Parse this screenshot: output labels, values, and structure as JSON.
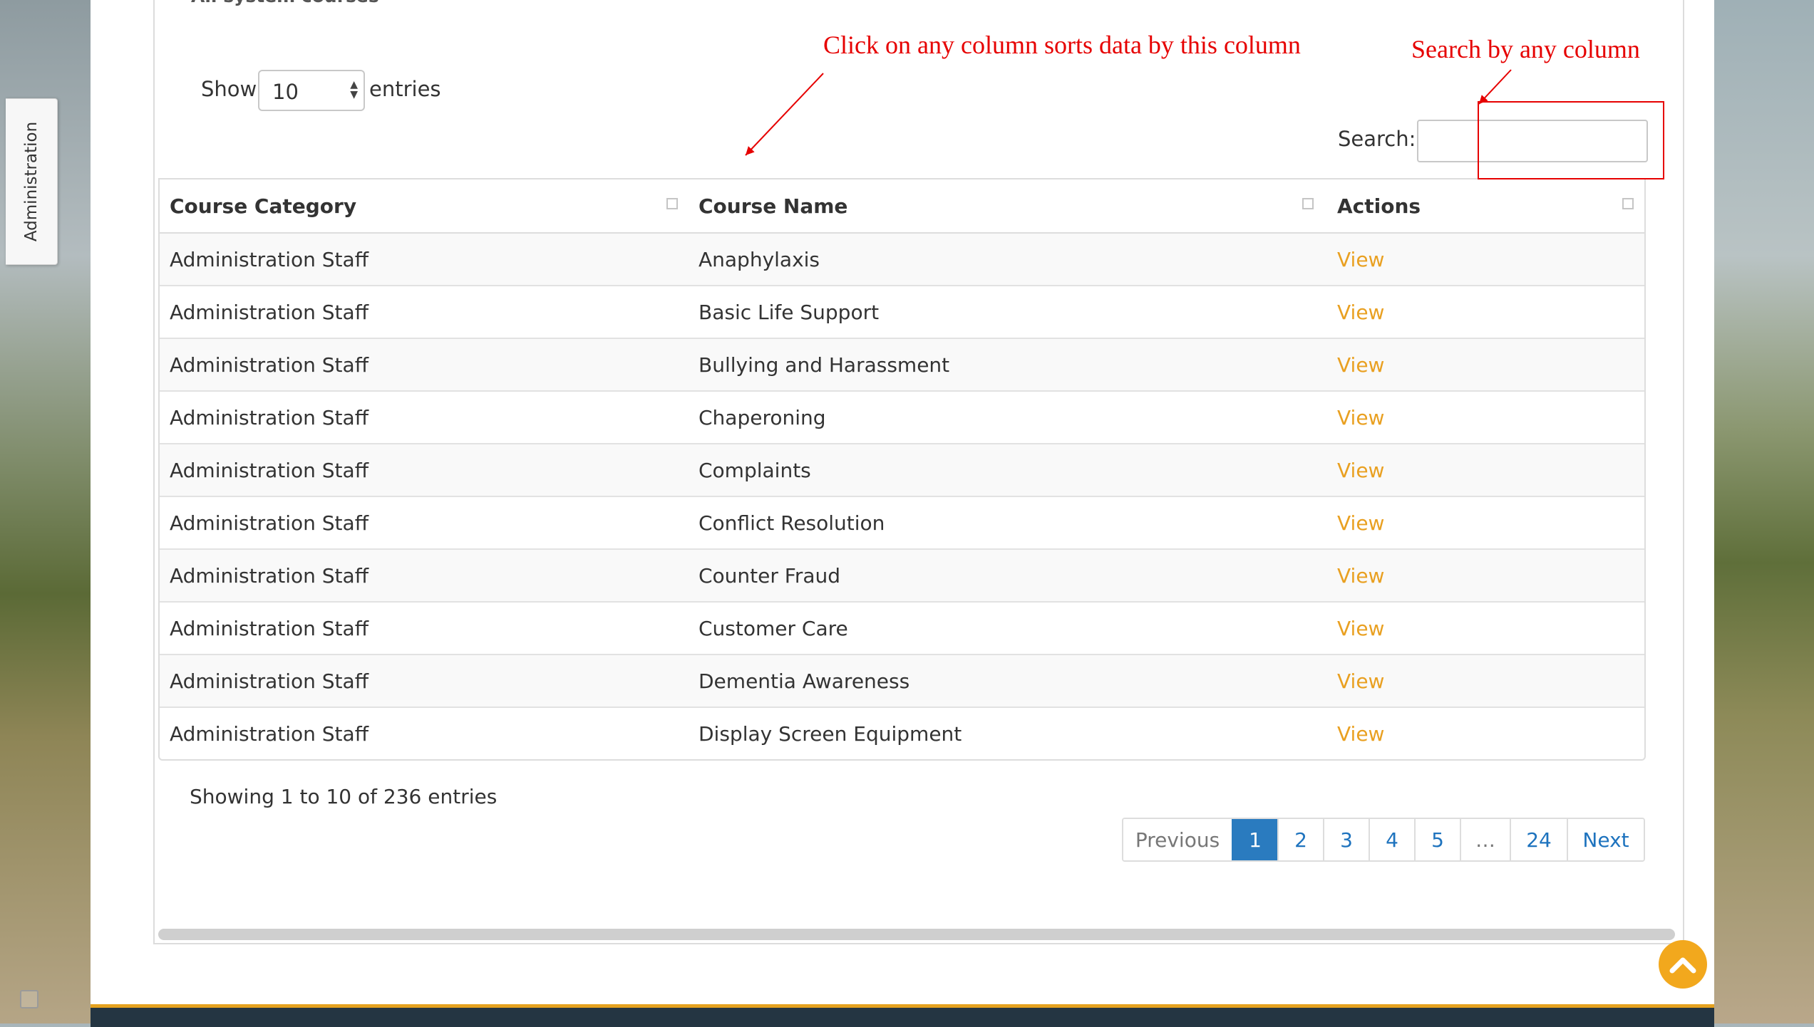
{
  "sidebar": {
    "admin_tab": "Administration"
  },
  "panel": {
    "title": "All system courses"
  },
  "length": {
    "show_label": "Show",
    "selected": "10",
    "entries_label": "entries"
  },
  "search": {
    "label": "Search:",
    "placeholder": "",
    "value": ""
  },
  "table": {
    "headers": [
      "Course Category",
      "Course Name",
      "Actions"
    ],
    "rows": [
      {
        "category": "Administration Staff",
        "name": "Anaphylaxis",
        "action": "View"
      },
      {
        "category": "Administration Staff",
        "name": "Basic Life Support",
        "action": "View"
      },
      {
        "category": "Administration Staff",
        "name": "Bullying and Harassment",
        "action": "View"
      },
      {
        "category": "Administration Staff",
        "name": "Chaperoning",
        "action": "View"
      },
      {
        "category": "Administration Staff",
        "name": "Complaints",
        "action": "View"
      },
      {
        "category": "Administration Staff",
        "name": "Conflict Resolution",
        "action": "View"
      },
      {
        "category": "Administration Staff",
        "name": "Counter Fraud",
        "action": "View"
      },
      {
        "category": "Administration Staff",
        "name": "Customer Care",
        "action": "View"
      },
      {
        "category": "Administration Staff",
        "name": "Dementia Awareness",
        "action": "View"
      },
      {
        "category": "Administration Staff",
        "name": "Display Screen Equipment",
        "action": "View"
      }
    ]
  },
  "info": "Showing 1 to 10 of 236 entries",
  "pagination": {
    "previous": "Previous",
    "pages": [
      "1",
      "2",
      "3",
      "4",
      "5",
      "…",
      "24"
    ],
    "active": "1",
    "next": "Next"
  },
  "annotations": {
    "sort_note": "Click on any column sorts data by this column",
    "search_note": "Search by any column"
  },
  "colors": {
    "link": "#e9a021",
    "active_page": "#2a7bbf",
    "annotation": "#e60000",
    "footer": "#243542",
    "footer_accent": "#e5a21f"
  },
  "icons": {
    "scroll_top": "chevron-up-icon",
    "sort": "sort-icon"
  }
}
